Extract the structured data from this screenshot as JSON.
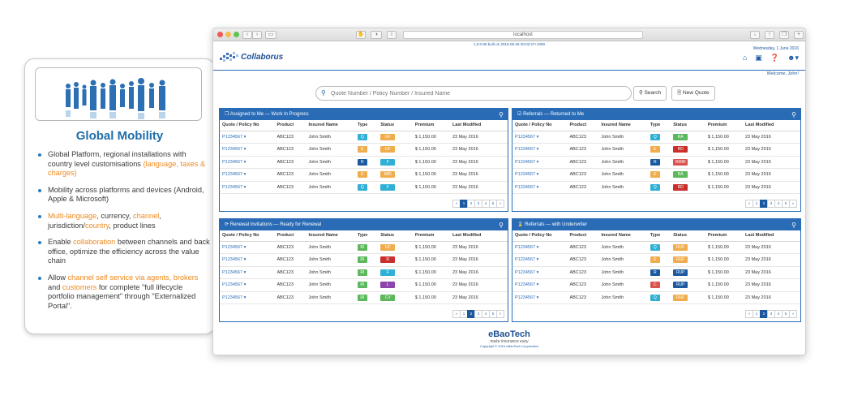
{
  "info_card": {
    "title": "Global Mobility",
    "bullets": [
      {
        "parts": [
          {
            "t": "Global Platform, regional installations  with country level customisations "
          },
          {
            "t": "(language, taxes & charges)",
            "hl": true
          }
        ]
      },
      {
        "parts": [
          {
            "t": "Mobility across platforms and devices (Android, Apple & Microsoft)"
          }
        ]
      },
      {
        "parts": [
          {
            "t": "Multi-language",
            "hl": true
          },
          {
            "t": ", currency, "
          },
          {
            "t": "channel",
            "hl": true
          },
          {
            "t": ", jurisdiction/"
          },
          {
            "t": "country",
            "hl": true
          },
          {
            "t": ", product lines"
          }
        ]
      },
      {
        "parts": [
          {
            "t": "Enable "
          },
          {
            "t": "collaboration",
            "hl": true
          },
          {
            "t": " between channels and back office, optimize the efficiency across the value chain"
          }
        ]
      },
      {
        "parts": [
          {
            "t": "Allow "
          },
          {
            "t": "channel self service via agents, brokers",
            "hl": true
          },
          {
            "t": " and "
          },
          {
            "t": "customers",
            "hl": true
          },
          {
            "t": " for complete \"full lifecycle portfolio management\" through \"Externalized Portal\"."
          }
        ]
      }
    ]
  },
  "browser": {
    "url": "localhost",
    "build_info": "1.0.0-06 built on 2016-05-26 20:02:27+1000",
    "date": "Wednesday, 1 June 2016",
    "app_name": "Collaborus",
    "welcome": "Welcome, John!"
  },
  "search": {
    "placeholder": "Quote Number / Policy Number / Insured Name",
    "search_label": "Search",
    "new_quote_label": "New Quote"
  },
  "columns": [
    "Quote / Policy No",
    "Product",
    "Insured Name",
    "Type",
    "Status",
    "Premium",
    "Last Modified"
  ],
  "type_colors": {
    "Q": "#31b0d5",
    "E": "#f0ad4e",
    "R": "#1c5aa0",
    "RI": "#5cb85c",
    "C": "#d9534f"
  },
  "status_colors": {
    "UF": "#f0ad4e",
    "F": "#31b0d5",
    "MIR": "#f0ad4e",
    "RA": "#5cb85c",
    "RD": "#c9302c",
    "RMIR": "#d9534f",
    "R": "#c9302c",
    "L": "#8e44ad",
    "CV": "#5cb85c",
    "RUF": "#f0ad4e",
    "RUP": "#1c5aa0"
  },
  "panels": [
    {
      "title": "Assigned to Me — Work In Progress",
      "head_icon": "folder-open-icon",
      "pages": [
        "«",
        "1",
        "2",
        "3",
        "4",
        "5",
        "»"
      ],
      "active_page": 1,
      "rows": [
        {
          "policy": "P1234567",
          "product": "ABC123",
          "insured": "John Smith",
          "type": "Q",
          "status": "UF",
          "premium": "$ 1,150.00",
          "modified": "23 May 2016"
        },
        {
          "policy": "P1234567",
          "product": "ABC123",
          "insured": "John Smith",
          "type": "E",
          "status": "UF",
          "premium": "$ 1,150.00",
          "modified": "23 May 2016"
        },
        {
          "policy": "P1234567",
          "product": "ABC123",
          "insured": "John Smith",
          "type": "R",
          "status": "F",
          "premium": "$ 1,150.00",
          "modified": "23 May 2016"
        },
        {
          "policy": "P1234567",
          "product": "ABC123",
          "insured": "John Smith",
          "type": "E",
          "status": "MIR",
          "premium": "$ 1,150.00",
          "modified": "23 May 2016"
        },
        {
          "policy": "P1234567",
          "product": "ABC123",
          "insured": "John Smith",
          "type": "Q",
          "status": "F",
          "premium": "$ 1,150.00",
          "modified": "23 May 2016"
        }
      ]
    },
    {
      "title": "Referrals — Returned to Me",
      "head_icon": "check-square-icon",
      "pages": [
        "«",
        "1",
        "2",
        "3",
        "4",
        "5",
        "»"
      ],
      "active_page": 2,
      "rows": [
        {
          "policy": "P1234567",
          "product": "ABC123",
          "insured": "John Smith",
          "type": "Q",
          "status": "RA",
          "premium": "$ 1,150.00",
          "modified": "23 May 2016"
        },
        {
          "policy": "P1234567",
          "product": "ABC123",
          "insured": "John Smith",
          "type": "E",
          "status": "RD",
          "premium": "$ 1,150.00",
          "modified": "23 May 2016"
        },
        {
          "policy": "P1234567",
          "product": "ABC123",
          "insured": "John Smith",
          "type": "R",
          "status": "RMIR",
          "premium": "$ 1,150.00",
          "modified": "23 May 2016"
        },
        {
          "policy": "P1234567",
          "product": "ABC123",
          "insured": "John Smith",
          "type": "E",
          "status": "RA",
          "premium": "$ 1,150.00",
          "modified": "23 May 2016"
        },
        {
          "policy": "P1234567",
          "product": "ABC123",
          "insured": "John Smith",
          "type": "Q",
          "status": "RD",
          "premium": "$ 1,150.00",
          "modified": "23 May 2016"
        }
      ]
    },
    {
      "title": "Renewal Invitations — Ready for Renewal",
      "head_icon": "refresh-icon",
      "pages": [
        "«",
        "1",
        "2",
        "3",
        "4",
        "5",
        "»"
      ],
      "active_page": 2,
      "rows": [
        {
          "policy": "P1234567",
          "product": "ABC123",
          "insured": "John Smith",
          "type": "RI",
          "status": "UF",
          "premium": "$ 1,150.00",
          "modified": "23 May 2016"
        },
        {
          "policy": "P1234567",
          "product": "ABC123",
          "insured": "John Smith",
          "type": "RI",
          "status": "R",
          "premium": "$ 1,150.00",
          "modified": "23 May 2016"
        },
        {
          "policy": "P1234567",
          "product": "ABC123",
          "insured": "John Smith",
          "type": "RI",
          "status": "F",
          "premium": "$ 1,150.00",
          "modified": "23 May 2016"
        },
        {
          "policy": "P1234567",
          "product": "ABC123",
          "insured": "John Smith",
          "type": "RI",
          "status": "L",
          "premium": "$ 1,150.00",
          "modified": "23 May 2016"
        },
        {
          "policy": "P1234567",
          "product": "ABC123",
          "insured": "John Smith",
          "type": "RI",
          "status": "CV",
          "premium": "$ 1,150.00",
          "modified": "23 May 2016"
        }
      ]
    },
    {
      "title": "Referrals — with Underwriter",
      "head_icon": "hourglass-icon",
      "pages": [
        "«",
        "1",
        "2",
        "3",
        "4",
        "5",
        "»"
      ],
      "active_page": 2,
      "rows": [
        {
          "policy": "P1234567",
          "product": "ABC123",
          "insured": "John Smith",
          "type": "Q",
          "status": "RUF",
          "premium": "$ 1,150.00",
          "modified": "23 May 2016"
        },
        {
          "policy": "P1234567",
          "product": "ABC123",
          "insured": "John Smith",
          "type": "E",
          "status": "RUF",
          "premium": "$ 1,150.00",
          "modified": "23 May 2016"
        },
        {
          "policy": "P1234567",
          "product": "ABC123",
          "insured": "John Smith",
          "type": "R",
          "status": "RUP",
          "premium": "$ 1,150.00",
          "modified": "23 May 2016"
        },
        {
          "policy": "P1234567",
          "product": "ABC123",
          "insured": "John Smith",
          "type": "C",
          "status": "RUP",
          "premium": "$ 1,150.00",
          "modified": "23 May 2016"
        },
        {
          "policy": "P1234567",
          "product": "ABC123",
          "insured": "John Smith",
          "type": "Q",
          "status": "RUF",
          "premium": "$ 1,150.00",
          "modified": "23 May 2016"
        }
      ]
    }
  ],
  "footer": {
    "brand": "eBaoTech",
    "tagline": "make insurance easy",
    "copyright": "Copyright © 2016 eBaoTech Corporation"
  }
}
